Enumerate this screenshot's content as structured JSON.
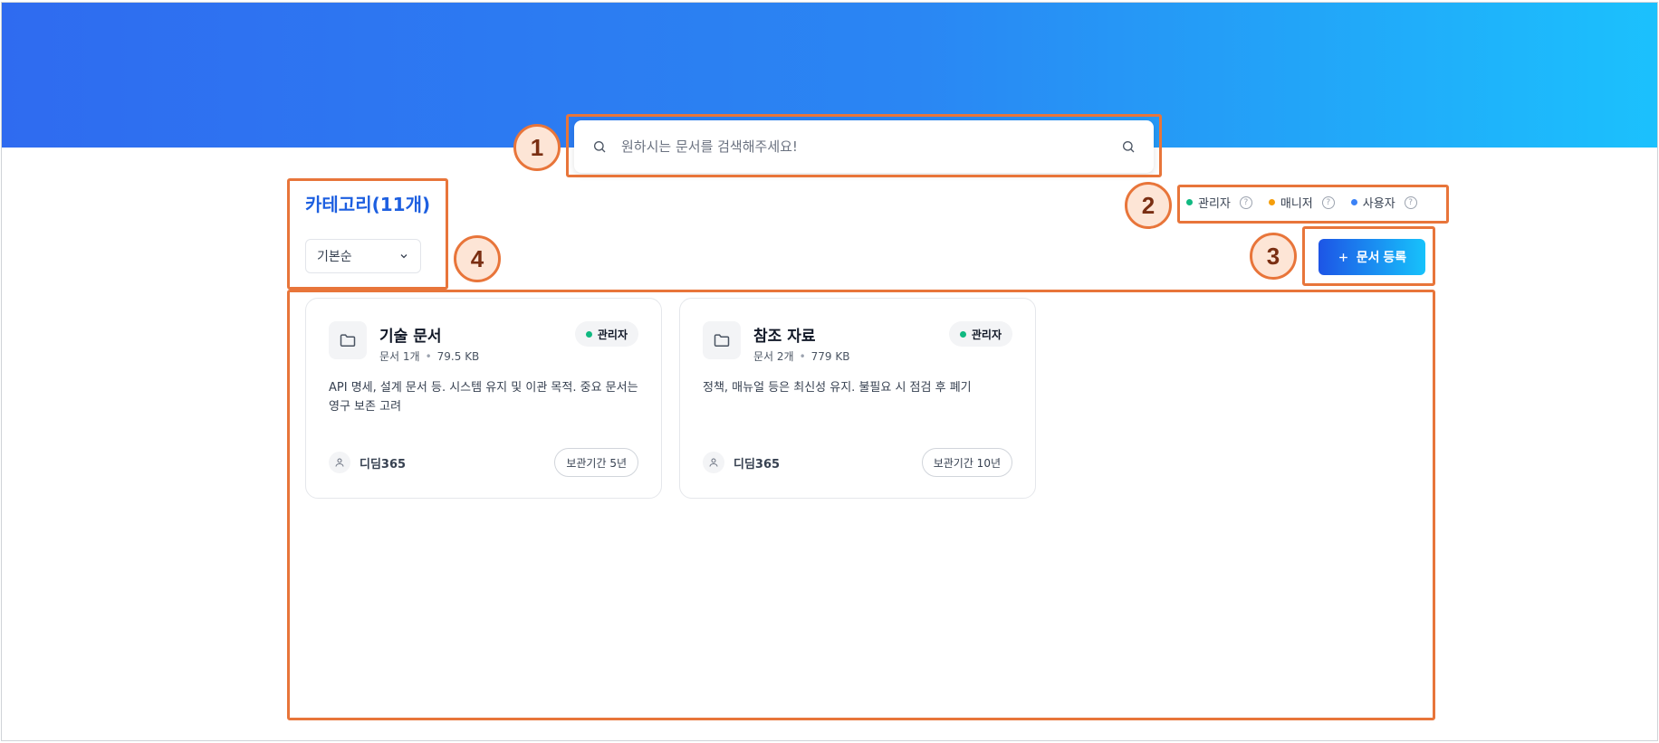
{
  "search": {
    "placeholder": "원하시는 문서를 검색해주세요!",
    "icon": "search-icon"
  },
  "category": {
    "title": "카테고리(11개)",
    "sort_label": "기본순"
  },
  "legend": [
    {
      "label": "관리자",
      "color": "#10b981"
    },
    {
      "label": "매니저",
      "color": "#f59e0b"
    },
    {
      "label": "사용자",
      "color": "#3b82f6"
    }
  ],
  "register_button": {
    "label": "문서 등록",
    "icon": "plus-icon"
  },
  "cards": [
    {
      "title": "기술 문서",
      "doc_count": "문서 1개",
      "size": "79.5 KB",
      "role": "관리자",
      "description": "API 명세, 설계 문서 등. 시스템 유지 및 이관 목적. 중요 문서는 영구 보존 고려",
      "owner": "디딤365",
      "retention": "보관기간 5년"
    },
    {
      "title": "참조 자료",
      "doc_count": "문서 2개",
      "size": "779 KB",
      "role": "관리자",
      "description": "정책, 매뉴얼 등은 최신성 유지. 불필요 시 점검 후 폐기",
      "owner": "디딤365",
      "retention": "보관기간 10년"
    }
  ],
  "annotations": [
    "1",
    "2",
    "3",
    "4"
  ],
  "colors": {
    "hero_start": "#2f6bf0",
    "hero_end": "#1bc1fd",
    "accent": "#1d5fe0",
    "annotation": "#e8753a",
    "admin_green": "#10b981"
  }
}
